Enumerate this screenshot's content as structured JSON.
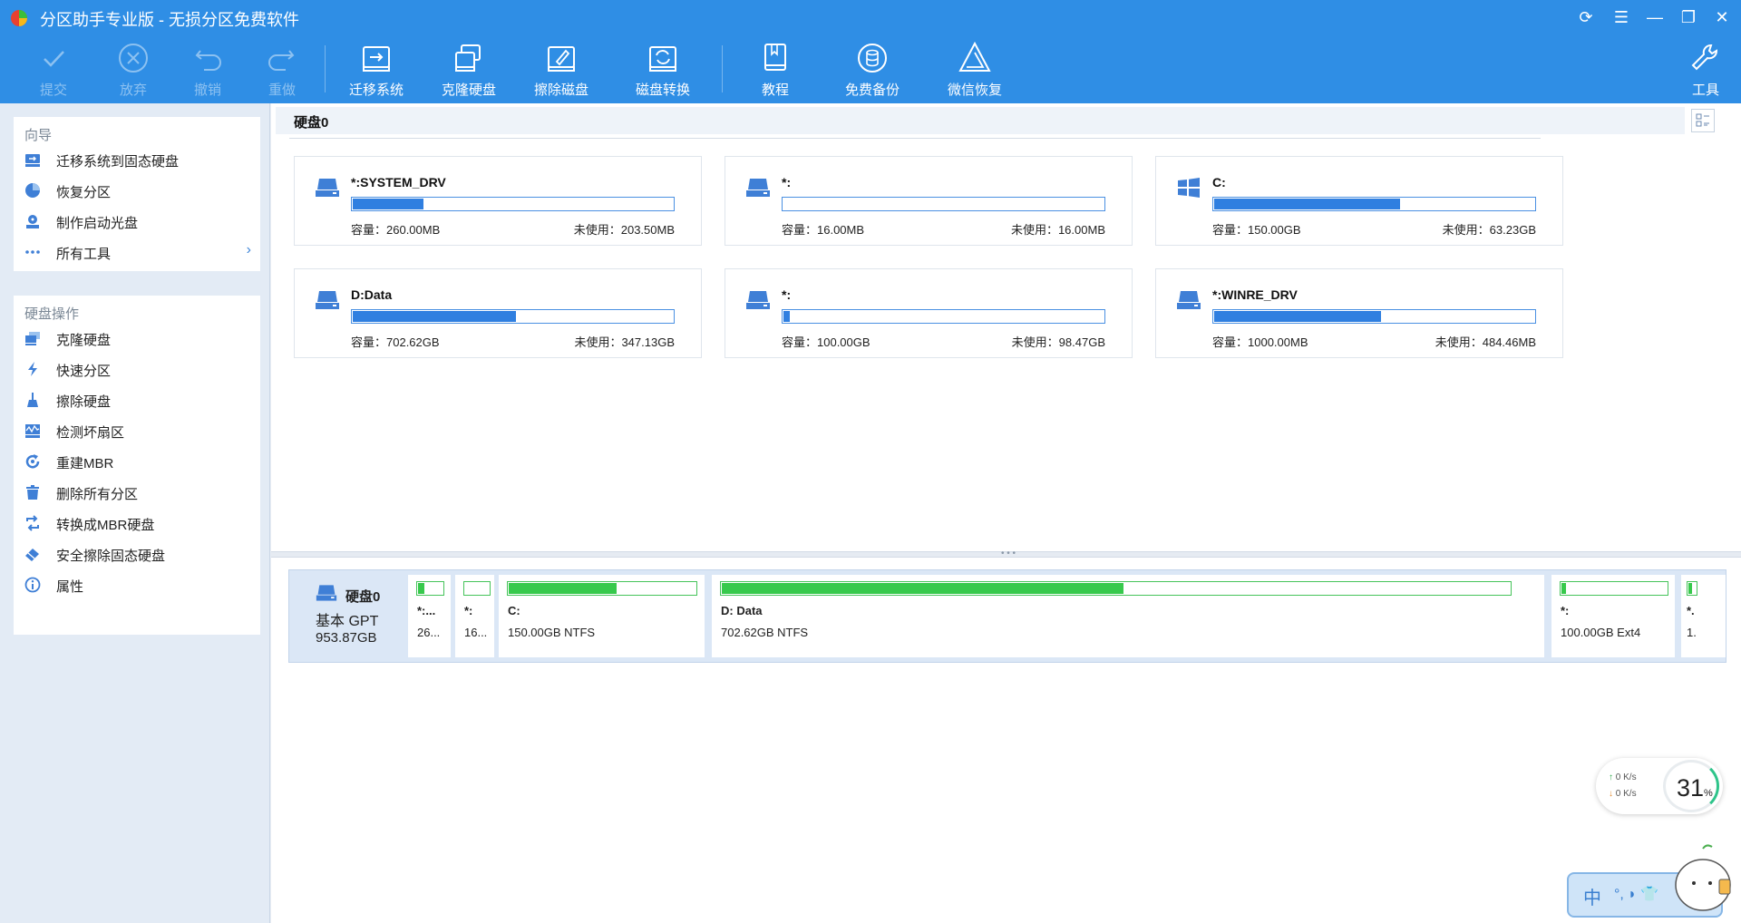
{
  "app": {
    "title": "分区助手专业版 - 无损分区免费软件",
    "accent_color": "#2f8ee5"
  },
  "window_controls": [
    {
      "name": "refresh-icon",
      "glyph": "⟳"
    },
    {
      "name": "menu-icon",
      "glyph": "☰"
    },
    {
      "name": "minimize-icon",
      "glyph": "—"
    },
    {
      "name": "restore-icon",
      "glyph": "❐"
    },
    {
      "name": "close-icon",
      "glyph": "✕"
    }
  ],
  "toolbar": {
    "submit": "提交",
    "discard": "放弃",
    "undo": "撤销",
    "redo": "重做",
    "migrate_os": "迁移系统",
    "clone_disk": "克隆硬盘",
    "wipe_disk": "擦除磁盘",
    "convert_disk": "磁盘转换",
    "tutorial": "教程",
    "free_backup": "免费备份",
    "wechat_recovery": "微信恢复",
    "tools": "工具"
  },
  "sidebar": {
    "wizard_heading": "向导",
    "wizard_items": [
      {
        "label": "迁移系统到固态硬盘",
        "icon": "migrate-icon"
      },
      {
        "label": "恢复分区",
        "icon": "pie-chart-icon"
      },
      {
        "label": "制作启动光盘",
        "icon": "boot-disc-icon"
      },
      {
        "label": "所有工具",
        "icon": "more-icon"
      }
    ],
    "disk_ops_heading": "硬盘操作",
    "disk_ops_items": [
      {
        "label": "克隆硬盘",
        "icon": "clone-icon"
      },
      {
        "label": "快速分区",
        "icon": "lightning-icon"
      },
      {
        "label": "擦除硬盘",
        "icon": "broom-icon"
      },
      {
        "label": "检测坏扇区",
        "icon": "wave-icon"
      },
      {
        "label": "重建MBR",
        "icon": "rebuild-icon"
      },
      {
        "label": "删除所有分区",
        "icon": "trash-icon"
      },
      {
        "label": "转换成MBR硬盘",
        "icon": "convert-icon"
      },
      {
        "label": "安全擦除固态硬盘",
        "icon": "eraser-icon"
      },
      {
        "label": "属性",
        "icon": "info-icon"
      }
    ]
  },
  "disk_panel": {
    "header": "硬盘0",
    "cap_prefix": "容量：",
    "free_prefix": "未使用："
  },
  "partitions": [
    {
      "name": "*:SYSTEM_DRV",
      "capacity": "容量：260.00MB",
      "free": "未使用：203.50MB",
      "used_fraction": 0.22,
      "icon": "drive-icon"
    },
    {
      "name": "*:",
      "capacity": "容量：16.00MB",
      "free": "未使用：16.00MB",
      "used_fraction": 0.0,
      "icon": "drive-icon"
    },
    {
      "name": "C:",
      "capacity": "容量：150.00GB",
      "free": "未使用：63.23GB",
      "used_fraction": 0.58,
      "icon": "windows-icon"
    },
    {
      "name": "D:Data",
      "capacity": "容量：702.62GB",
      "free": "未使用：347.13GB",
      "used_fraction": 0.51,
      "icon": "drive-icon"
    },
    {
      "name": "*:",
      "capacity": "容量：100.00GB",
      "free": "未使用：98.47GB",
      "used_fraction": 0.02,
      "icon": "drive-icon"
    },
    {
      "name": "*:WINRE_DRV",
      "capacity": "容量：1000.00MB",
      "free": "未使用：484.46MB",
      "used_fraction": 0.52,
      "icon": "drive-icon"
    }
  ],
  "disk_map": {
    "name": "硬盘0",
    "type": "基本 GPT",
    "size": "953.87GB",
    "segments": [
      {
        "name": "*:...",
        "info": "26...",
        "used_fraction": 0.25
      },
      {
        "name": "*:",
        "info": "16...",
        "used_fraction": 0.0
      },
      {
        "name": "C:",
        "info": "150.00GB NTFS",
        "used_fraction": 0.58
      },
      {
        "name": "D: Data",
        "info": "702.62GB NTFS",
        "used_fraction": 0.51
      },
      {
        "name": "*:",
        "info": "100.00GB Ext4",
        "used_fraction": 0.04
      },
      {
        "name": "*.",
        "info": "1.",
        "used_fraction": 0.5
      }
    ]
  },
  "net_widget": {
    "up": "0  K/s",
    "down": "0  K/s",
    "percent": "31",
    "percent_unit": "%"
  },
  "ime": {
    "mode": "中",
    "icons": "°, ◗ 👕"
  }
}
